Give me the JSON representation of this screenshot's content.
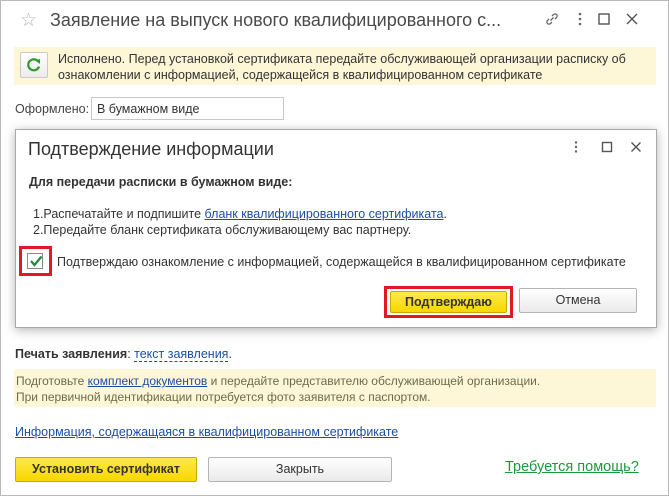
{
  "window": {
    "title": "Заявление на выпуск нового квалифицированного с...",
    "icons": [
      "star-icon",
      "link-icon",
      "more-icon",
      "maximize-icon",
      "close-icon"
    ]
  },
  "notice": {
    "text": "Исполнено. Перед установкой сертификата передайте обслуживающей организации расписку об ознакомлении с информацией, содержащейся в квалифицированном сертификате"
  },
  "form": {
    "issued_label": "Оформлено:",
    "issued_value": "В бумажном виде"
  },
  "print": {
    "label": "Печать заявления",
    "colon": ": ",
    "link": "текст заявления",
    "dot": "."
  },
  "hint": {
    "part1": "Подготовьте ",
    "link": "комплект документов",
    "part2": " и передайте представителю обслуживающей организации.",
    "line2": "При первичной идентификации потребуется фото заявителя с паспортом."
  },
  "info_link": "Информация, содержащаяся в квалифицированном сертификате",
  "buttons": {
    "install": "Установить сертификат",
    "close": "Закрыть",
    "help": "Требуется помощь?"
  },
  "dialog": {
    "title": "Подтверждение информации",
    "subtitle": "Для передачи расписки в бумажном виде:",
    "step1_prefix": "1.Распечатайте и подпишите ",
    "step1_link": "бланк квалифицированного сертификата",
    "step1_suffix": ".",
    "step2": "2.Передайте бланк сертификата обслуживающему вас партнеру.",
    "checkbox_label": "Подтверждаю ознакомление с информацией, содержащейся в квалифицированном сертификате",
    "checkbox_checked": true,
    "confirm": "Подтверждаю",
    "cancel": "Отмена"
  },
  "colors": {
    "accent_yellow": "#f7d700",
    "highlight_red": "#e01a22",
    "link_blue": "#1c4fa3",
    "help_green": "#1a9a3a",
    "notice_bg": "#fdf7d7"
  }
}
